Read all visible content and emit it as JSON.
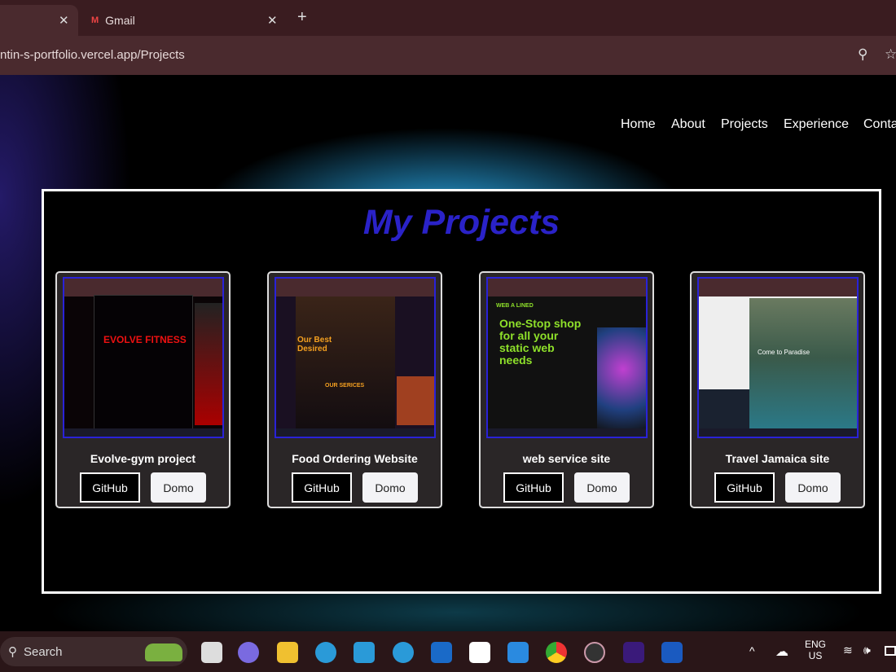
{
  "browser": {
    "tabs": [
      {
        "label": "",
        "active": true
      },
      {
        "label": "Gmail",
        "icon": "gmail-icon"
      }
    ],
    "url": "ntin-s-portfolio.vercel.app/Projects"
  },
  "nav": [
    "Home",
    "About",
    "Projects",
    "Experience",
    "Conta"
  ],
  "section_title": "My Projects",
  "colors": {
    "title": "#2a22c8",
    "card_bg": "#2a2627"
  },
  "projects": [
    {
      "name": "Evolve-gym project",
      "github": "GitHub",
      "demo": "Domo",
      "thumb_text": "EVOLVE FITNESS"
    },
    {
      "name": "Food Ordering Website",
      "github": "GitHub",
      "demo": "Domo",
      "thumb_text": "Our Best Desired",
      "thumb_sub": "OUR SERICES"
    },
    {
      "name": "web service site",
      "github": "GitHub",
      "demo": "Domo",
      "thumb_text": "One-Stop shop for all your static web needs",
      "thumb_sub": "WEB A LINED"
    },
    {
      "name": "Travel Jamaica site",
      "github": "GitHub",
      "demo": "Domo",
      "thumb_text": "Come to Paradise"
    }
  ],
  "taskbar": {
    "search": "Search",
    "lang": "ENG",
    "region": "US"
  }
}
